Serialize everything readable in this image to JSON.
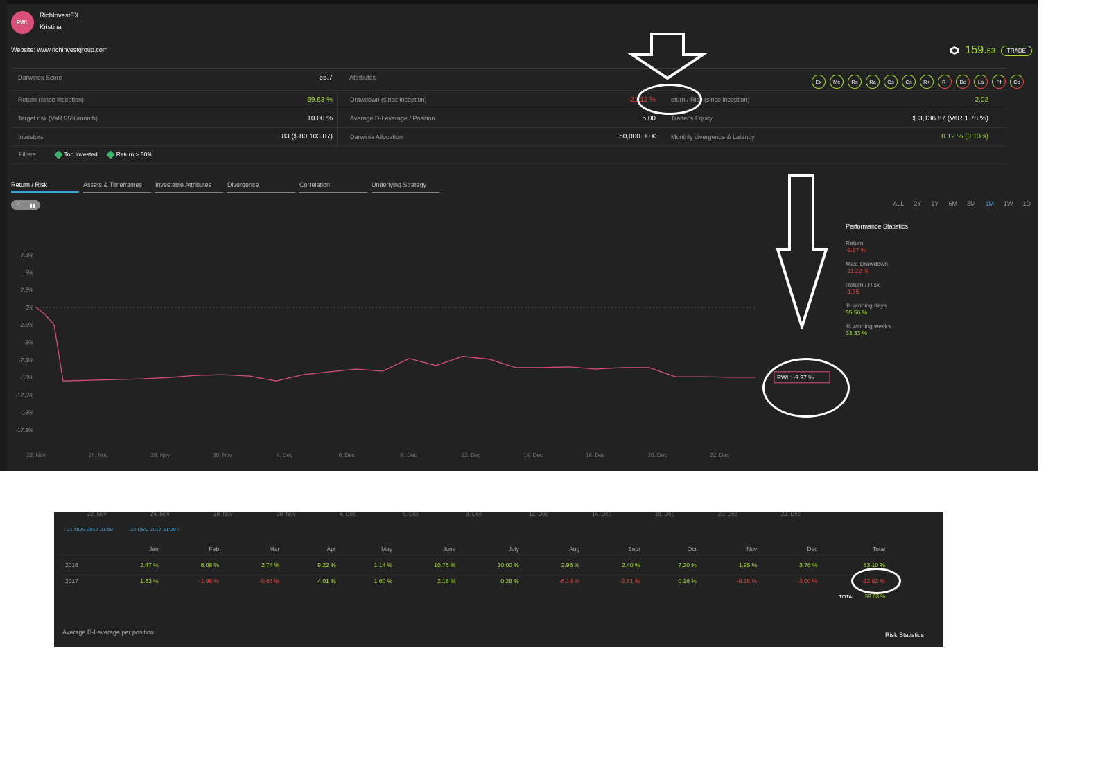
{
  "header": {
    "avatar_text": "RWL",
    "brand": "RichInvestFX",
    "trader": "Kristina",
    "website": "Website: www.richinvestgroup.com",
    "price_main": "159.",
    "price_decimals": "63",
    "trade_label": "TRADE"
  },
  "stats": {
    "darwinex_score_label": "Darwinex Score",
    "darwinex_score": "55.7",
    "attributes_label": "Attributes",
    "return_label": "Return (since inception)",
    "return_value": "59.63 %",
    "drawdown_label": "Drawdown (since inception)",
    "drawdown_value": "-21.12 %",
    "return_risk_label": "eturn / Risk (since inception)",
    "return_risk_value": "2.02",
    "target_risk_label": "Target risk (VaR 95%/month)",
    "target_risk_value": "10.00 %",
    "avg_leverage_label": "Average D-Leverage / Position",
    "avg_leverage_value": "5.00",
    "equity_label": "Trader's Equity",
    "equity_value": "$ 3,136.87 (VaR 1.78 %)",
    "investors_label": "Investors",
    "investors_value": "83 ($ 80,103.07)",
    "allocation_label": "Darwinia Allocation",
    "allocation_value": "50,000.00 €",
    "divergence_label": "Monthly divergence & Latency",
    "divergence_value": "0.12 % (0.13 s)"
  },
  "attributes": [
    {
      "code": "Ex",
      "state": "full"
    },
    {
      "code": "Mc",
      "state": "full"
    },
    {
      "code": "Rs",
      "state": "full"
    },
    {
      "code": "Ra",
      "state": "full"
    },
    {
      "code": "Os",
      "state": "full"
    },
    {
      "code": "Cs",
      "state": "full"
    },
    {
      "code": "R+",
      "state": "full"
    },
    {
      "code": "R-",
      "state": "half"
    },
    {
      "code": "Dc",
      "state": "half"
    },
    {
      "code": "La",
      "state": "half"
    },
    {
      "code": "Pf",
      "state": "half"
    },
    {
      "code": "Cp",
      "state": "half"
    }
  ],
  "filters": {
    "label": "Filters",
    "chips": [
      "Top Invested",
      "Return > 50%"
    ]
  },
  "tabs": [
    "Return / Risk",
    "Assets & Timeframes",
    "Investable Attributes",
    "Divergence",
    "Correlation",
    "Underlying Strategy"
  ],
  "timeframes": [
    "ALL",
    "2Y",
    "1Y",
    "6M",
    "3M",
    "1M",
    "1W",
    "1D"
  ],
  "selected_timeframe": "1M",
  "performance": {
    "title": "Performance Statistics",
    "items": [
      {
        "label": "Return",
        "value": "-9.97 %",
        "color": "red"
      },
      {
        "label": "Max. Drawdown",
        "value": "-11.22 %",
        "color": "red"
      },
      {
        "label": "Return / Risk",
        "value": "-1.56",
        "color": "red"
      },
      {
        "label": "% winning days",
        "value": "55.56 %",
        "color": "green"
      },
      {
        "label": "% winning weeks",
        "value": "33.33 %",
        "color": "green"
      }
    ]
  },
  "chart_data": {
    "type": "line",
    "y_ticks": [
      "7.5%",
      "5%",
      "2.5%",
      "0%",
      "-2.5%",
      "-5%",
      "-7.5%",
      "-10%",
      "-12.5%",
      "-15%",
      "-17.5%"
    ],
    "ylim": [
      -17.5,
      7.5
    ],
    "x_ticks": [
      "22. Nov",
      "24. Nov",
      "28. Nov",
      "30. Nov",
      "4. Dec",
      "6. Dec",
      "8. Dec",
      "12. Dec",
      "14. Dec",
      "18. Dec",
      "20. Dec",
      "22. Dec"
    ],
    "series": [
      {
        "name": "RWL",
        "color": "#d9507a",
        "values": [
          0,
          -1,
          -2.5,
          -10.5,
          -10.4,
          -10.3,
          -10.2,
          -10,
          -9.7,
          -9.6,
          -9.8,
          -10.5,
          -9.6,
          -9.2,
          -8.8,
          -9.1,
          -7.3,
          -8.3,
          -7,
          -7.4,
          -8.6,
          -8.6,
          -8.5,
          -8.8,
          -8.6,
          -8.6,
          -9.9,
          -9.9,
          -9.97,
          -9.97
        ]
      }
    ],
    "end_label": "RWL: -9.97 %"
  },
  "bottom": {
    "x_ticks": [
      "22. Nov",
      "24. Nov",
      "28. Nov",
      "30. Nov",
      "4. Dec",
      "6. Dec",
      "8. Dec",
      "12. Dec",
      "14. Dec",
      "18. Dec",
      "20. Dec",
      "22. Dec"
    ],
    "date_from": "21 NOV 2017 21:59",
    "date_to": "22 DEC 2017 21:28",
    "months": [
      "Jan",
      "Feb",
      "Mar",
      "Apr",
      "May",
      "June",
      "July",
      "Aug",
      "Sept",
      "Oct",
      "Nov",
      "Dec",
      "Total"
    ],
    "rows": [
      {
        "year": "2016",
        "values": [
          "2.47 %",
          "8.08 %",
          "2.74 %",
          "9.22 %",
          "1.14 %",
          "10.76 %",
          "10.00 %",
          "2.96 %",
          "2.40 %",
          "7.20 %",
          "1.95 %",
          "3.76 %",
          "83.10 %"
        ]
      },
      {
        "year": "2017",
        "values": [
          "1.63 %",
          "-1.98 %",
          "-0.66 %",
          "4.01 %",
          "1.60 %",
          "2.18 %",
          "0.28 %",
          "-6.18 %",
          "-2.81 %",
          "0.16 %",
          "-8.15 %",
          "-3.00 %",
          "-12.82 %"
        ]
      }
    ],
    "total_label": "TOTAL",
    "total_value": "59.63 %",
    "avg_leverage_label": "Average D-Leverage per position",
    "risk_stats_label": "Risk Statistics"
  }
}
